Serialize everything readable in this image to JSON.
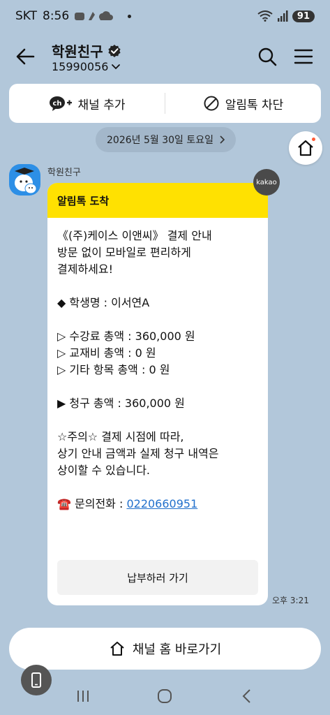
{
  "status": {
    "carrier": "SKT",
    "time": "8:56",
    "battery": "91"
  },
  "header": {
    "title": "학원친구",
    "subtitle": "15990056"
  },
  "actions": {
    "add_channel": "채널 추가",
    "block": "알림톡 차단"
  },
  "date": "2026년 5월 30일 토요일",
  "message": {
    "sender": "학원친구",
    "badge": "kakao",
    "header": "알림톡 도착",
    "lines": [
      "《(주)케이스 이앤씨》 결제 안내",
      "방문 없이 모바일로 편리하게",
      "결제하세요!",
      "",
      "◆ 학생명 : 이서연A",
      "",
      "▷ 수강료 총액 : 360,000 원",
      "▷ 교재비 총액 : 0 원",
      "▷ 기타 항목 총액 : 0 원",
      "",
      "▶ 청구 총액 : 360,000 원",
      "",
      "☆주의☆ 결제 시점에 따라,",
      "상기 안내 금액과 실제 청구 내역은",
      "상이할 수 있습니다.",
      ""
    ],
    "phone_label": "☎️ 문의전화 : ",
    "phone_number": "0220660951",
    "pay_button": "납부하러 가기",
    "time": "오후 3:21"
  },
  "home_shortcut": "채널 홈 바로가기"
}
